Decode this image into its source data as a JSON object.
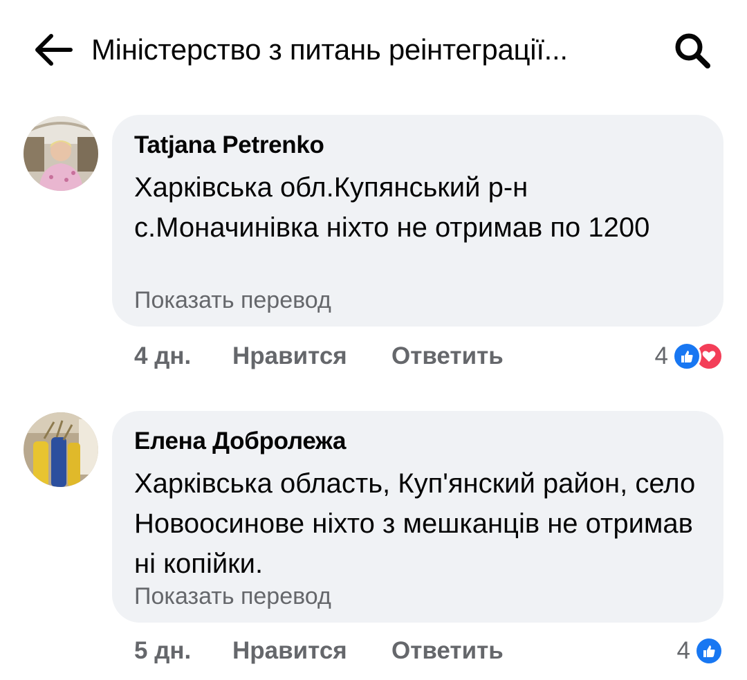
{
  "header": {
    "title": "Міністерство з питань реінтеграції..."
  },
  "comments": [
    {
      "author": "Tatjana Petrenko",
      "text": "Харківська обл.Купянський р-н с.Моначинівка ніхто не отримав по 1200",
      "translate_label": "Показать перевод",
      "time": "4 дн.",
      "like_label": "Нравится",
      "reply_label": "Ответить",
      "reaction_count": "4",
      "reactions": [
        "like-icon",
        "love-icon"
      ]
    },
    {
      "author": "Елена Добролежа",
      "text": "Харківська область, Куп'янский район, село Новоосинове ніхто з мешканців не отримав ні копійки.",
      "translate_label": "Показать перевод",
      "time": "5 дн.",
      "like_label": "Нравится",
      "reply_label": "Ответить",
      "reaction_count": "4",
      "reactions": [
        "like-icon"
      ]
    }
  ],
  "colors": {
    "bubble": "#f0f2f5",
    "secondary_text": "#65676b",
    "like_blue": "#1877f2",
    "love_red": "#f33e58"
  }
}
